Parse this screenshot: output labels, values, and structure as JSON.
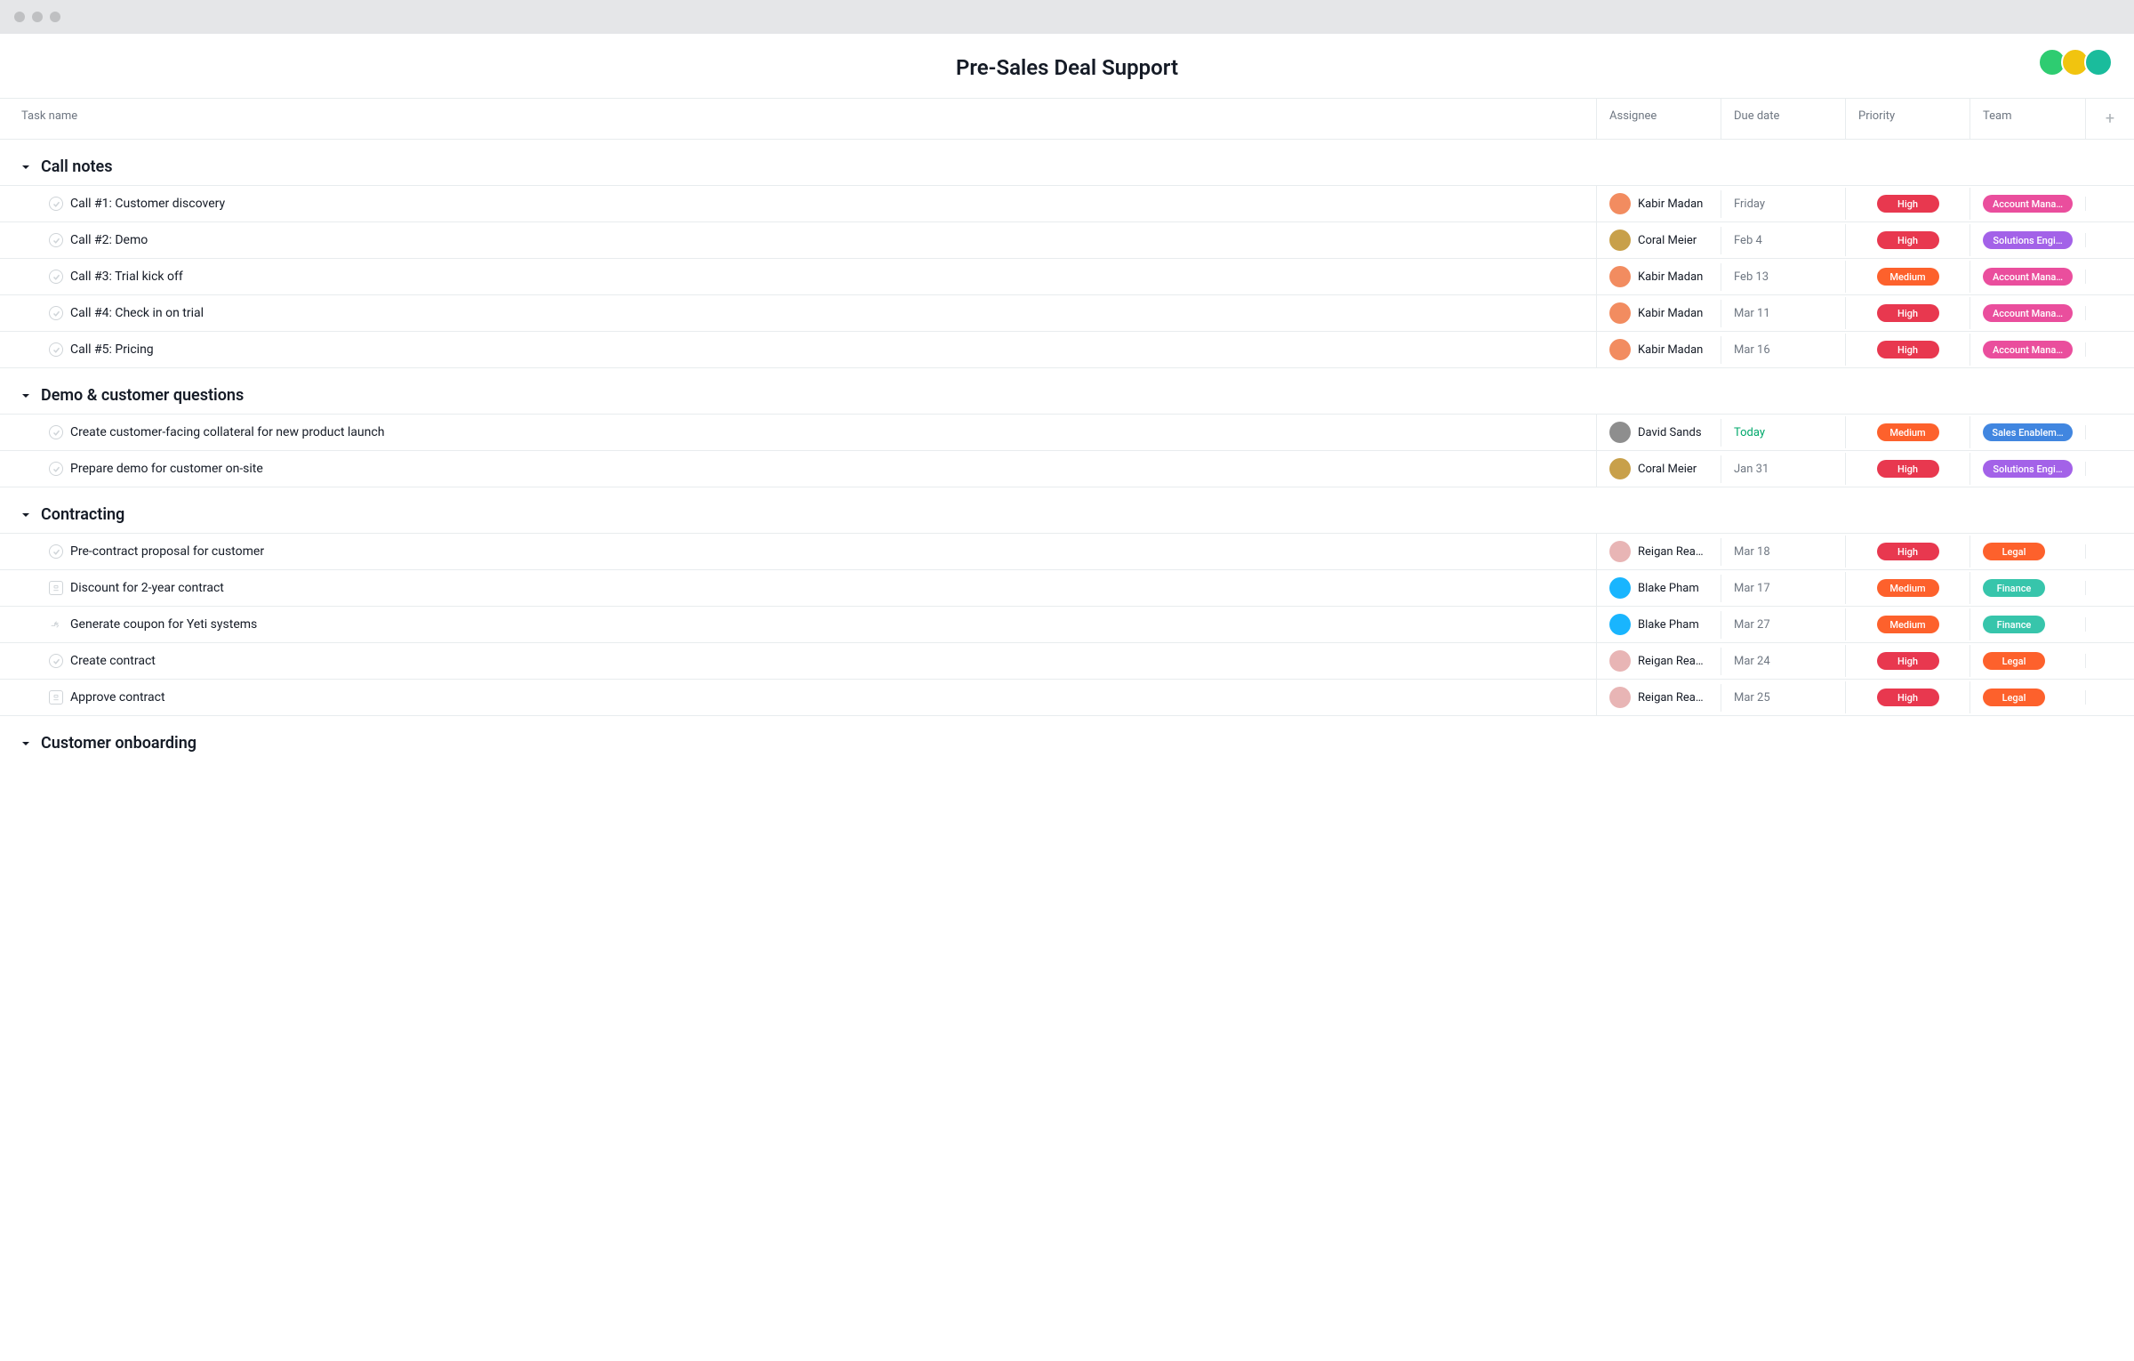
{
  "project_title": "Pre-Sales Deal Support",
  "columns": {
    "task": "Task name",
    "assignee": "Assignee",
    "due": "Due date",
    "priority": "Priority",
    "team": "Team",
    "add": "+"
  },
  "sections": [
    {
      "title": "Call notes",
      "tasks": [
        {
          "icon": "check",
          "name": "Call #1: Customer discovery",
          "assignee": "Kabir Madan",
          "avatar": "av-kabir",
          "due": "Friday",
          "due_class": "",
          "priority": "High",
          "priority_class": "p-high",
          "team": "Account Mana…",
          "team_class": "t-account"
        },
        {
          "icon": "check",
          "name": "Call #2: Demo",
          "assignee": "Coral Meier",
          "avatar": "av-coral",
          "due": "Feb 4",
          "due_class": "",
          "priority": "High",
          "priority_class": "p-high",
          "team": "Solutions Engi…",
          "team_class": "t-solutions"
        },
        {
          "icon": "check",
          "name": "Call #3: Trial kick off",
          "assignee": "Kabir Madan",
          "avatar": "av-kabir",
          "due": "Feb 13",
          "due_class": "",
          "priority": "Medium",
          "priority_class": "p-medium",
          "team": "Account Mana…",
          "team_class": "t-account"
        },
        {
          "icon": "check",
          "name": "Call #4: Check in on trial",
          "assignee": "Kabir Madan",
          "avatar": "av-kabir",
          "due": "Mar 11",
          "due_class": "",
          "priority": "High",
          "priority_class": "p-high",
          "team": "Account Mana…",
          "team_class": "t-account"
        },
        {
          "icon": "check",
          "name": "Call #5: Pricing",
          "assignee": "Kabir Madan",
          "avatar": "av-kabir",
          "due": "Mar 16",
          "due_class": "",
          "priority": "High",
          "priority_class": "p-high",
          "team": "Account Mana…",
          "team_class": "t-account"
        }
      ]
    },
    {
      "title": "Demo & customer questions",
      "tasks": [
        {
          "icon": "check",
          "name": "Create customer-facing collateral for new product launch",
          "assignee": "David Sands",
          "avatar": "av-david",
          "due": "Today",
          "due_class": "today",
          "priority": "Medium",
          "priority_class": "p-medium",
          "team": "Sales Enablem…",
          "team_class": "t-sales"
        },
        {
          "icon": "check",
          "name": "Prepare demo for customer on-site",
          "assignee": "Coral Meier",
          "avatar": "av-coral",
          "due": "Jan 31",
          "due_class": "",
          "priority": "High",
          "priority_class": "p-high",
          "team": "Solutions Engi…",
          "team_class": "t-solutions"
        }
      ]
    },
    {
      "title": "Contracting",
      "tasks": [
        {
          "icon": "check",
          "name": "Pre-contract proposal for customer",
          "assignee": "Reigan Rea…",
          "avatar": "av-reigan",
          "due": "Mar 18",
          "due_class": "",
          "priority": "High",
          "priority_class": "p-high",
          "team": "Legal",
          "team_class": "t-legal"
        },
        {
          "icon": "square",
          "name": "Discount for 2-year contract",
          "assignee": "Blake Pham",
          "avatar": "av-blake",
          "due": "Mar 17",
          "due_class": "",
          "priority": "Medium",
          "priority_class": "p-medium",
          "team": "Finance",
          "team_class": "t-finance"
        },
        {
          "icon": "hand",
          "name": "Generate coupon for Yeti systems",
          "assignee": "Blake Pham",
          "avatar": "av-blake",
          "due": "Mar 27",
          "due_class": "",
          "priority": "Medium",
          "priority_class": "p-medium",
          "team": "Finance",
          "team_class": "t-finance"
        },
        {
          "icon": "check",
          "name": "Create contract",
          "assignee": "Reigan Rea…",
          "avatar": "av-reigan",
          "due": "Mar 24",
          "due_class": "",
          "priority": "High",
          "priority_class": "p-high",
          "team": "Legal",
          "team_class": "t-legal"
        },
        {
          "icon": "square",
          "name": "Approve contract",
          "assignee": "Reigan Rea…",
          "avatar": "av-reigan",
          "due": "Mar 25",
          "due_class": "",
          "priority": "High",
          "priority_class": "p-high",
          "team": "Legal",
          "team_class": "t-legal"
        }
      ]
    },
    {
      "title": "Customer onboarding",
      "tasks": []
    }
  ]
}
